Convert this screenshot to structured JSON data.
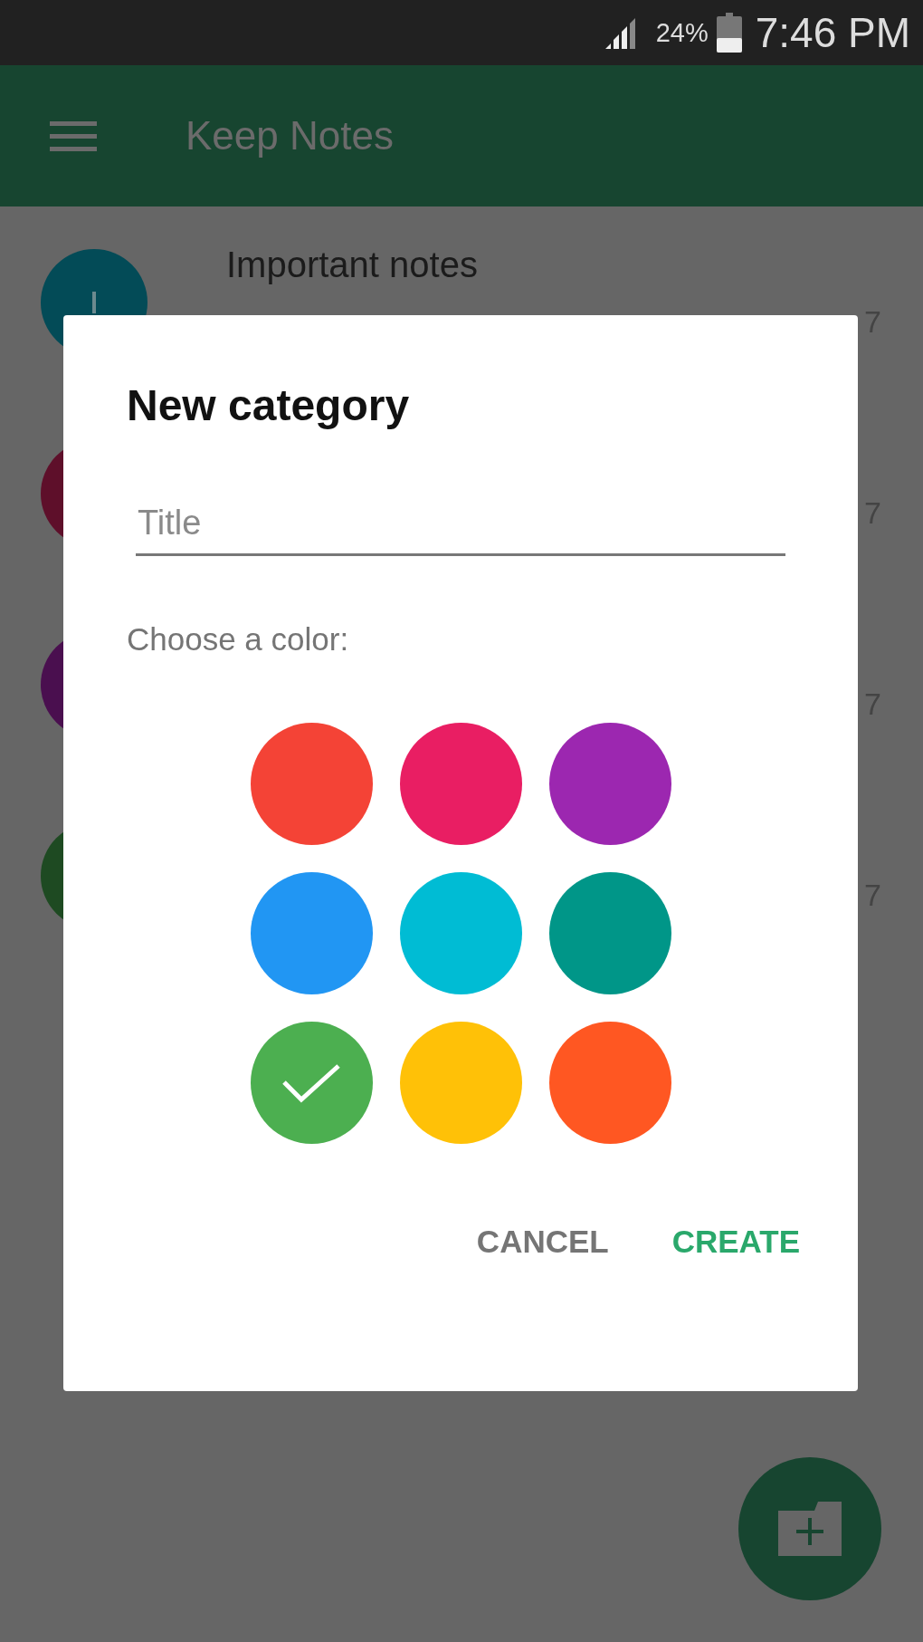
{
  "status_bar": {
    "battery": "24%",
    "time": "7:46 PM"
  },
  "app_bar": {
    "title": "Keep Notes"
  },
  "categories": [
    {
      "title": "Important notes",
      "count": "7",
      "color": "#034b57"
    },
    {
      "count": "7",
      "color": "#5e0f2a"
    },
    {
      "count": "7",
      "color": "#4a0f4f"
    },
    {
      "count": "7",
      "color": "#1e4a22"
    }
  ],
  "dialog": {
    "title": "New category",
    "field": {
      "placeholder": "Title"
    },
    "label": "Choose a color:",
    "colors": [
      {
        "color": "#f44336",
        "selected": false
      },
      {
        "color": "#e91e63",
        "selected": false
      },
      {
        "color": "#9c27b0",
        "selected": false
      },
      {
        "color": "#2196f3",
        "selected": false
      },
      {
        "color": "#00bcd4",
        "selected": false
      },
      {
        "color": "#009688",
        "selected": false
      },
      {
        "color": "#4caf50",
        "selected": true
      },
      {
        "color": "#ffc107",
        "selected": false
      },
      {
        "color": "#ff5722",
        "selected": false
      }
    ],
    "buttons": [
      {
        "label": "CANCEL",
        "kind": "secondary"
      },
      {
        "label": "CREATE",
        "kind": "primary"
      }
    ]
  }
}
